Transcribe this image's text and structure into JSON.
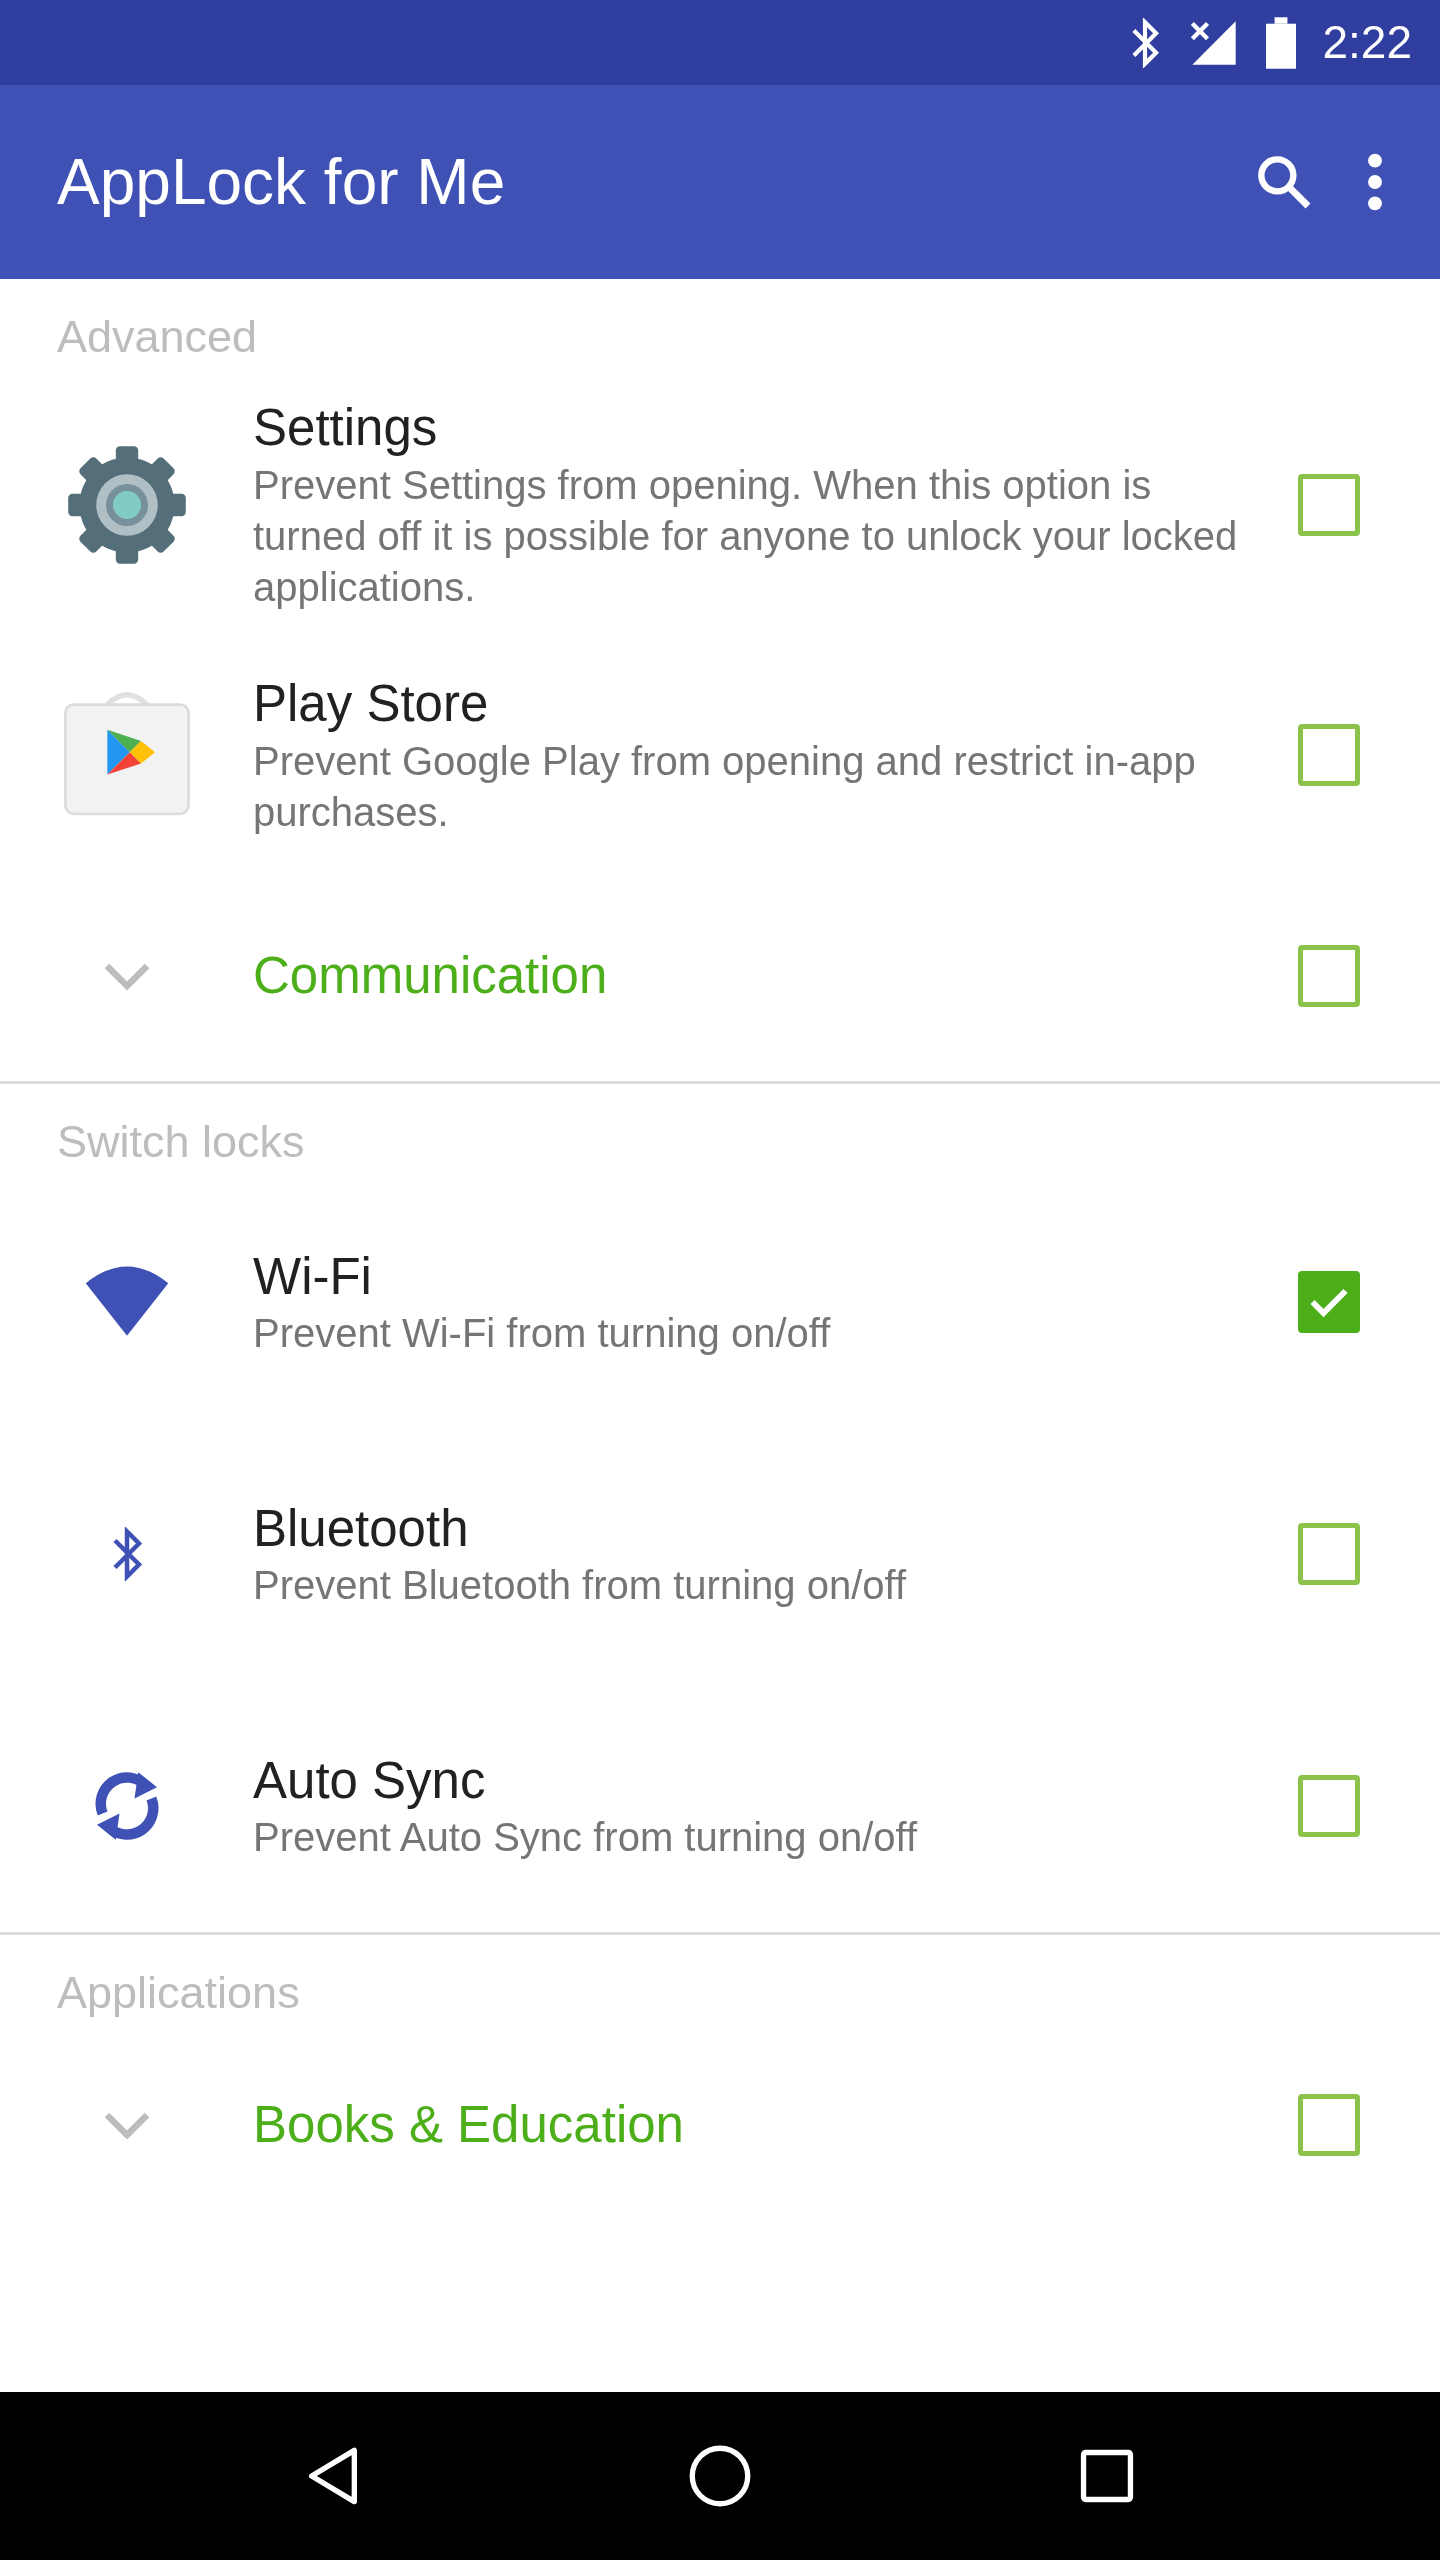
{
  "status_bar": {
    "time": "2:22"
  },
  "app_bar": {
    "title": "AppLock for Me"
  },
  "sections": [
    {
      "header": "Advanced",
      "items": [
        {
          "kind": "app",
          "title": "Settings",
          "description": "Prevent Settings from opening. When this option is turned off it is possible for anyone to unlock your locked applications.",
          "checked": false
        },
        {
          "kind": "app",
          "title": "Play Store",
          "description": "Prevent Google Play from opening and restrict in-app purchases.",
          "checked": false
        },
        {
          "kind": "category",
          "title": "Communication",
          "checked": false
        }
      ]
    },
    {
      "header": "Switch locks",
      "items": [
        {
          "kind": "app",
          "title": "Wi-Fi",
          "description": "Prevent Wi-Fi from turning on/off",
          "checked": true
        },
        {
          "kind": "app",
          "title": "Bluetooth",
          "description": "Prevent Bluetooth from turning on/off",
          "checked": false
        },
        {
          "kind": "app",
          "title": "Auto Sync",
          "description": "Prevent Auto Sync from turning on/off",
          "checked": false
        }
      ]
    },
    {
      "header": "Applications",
      "items": [
        {
          "kind": "category",
          "title": "Books & Education",
          "checked": false
        }
      ]
    }
  ]
}
